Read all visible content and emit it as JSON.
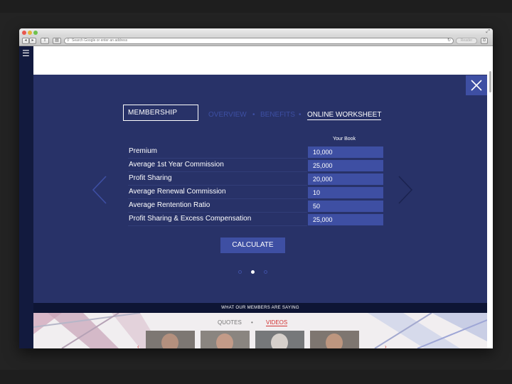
{
  "browser": {
    "address_placeholder": "Search Google or enter an address",
    "reader_label": "Reader"
  },
  "icons": {
    "menu": "hamburger-icon",
    "close": "close-icon",
    "prev": "chevron-left-icon",
    "next": "chevron-right-icon"
  },
  "colors": {
    "page_dark": "#283268",
    "accent_blue": "#3e4fa3",
    "sidebar": "#121a3e",
    "highlight_red": "#d23030"
  },
  "tabs": {
    "membership": "MEMBERSHIP",
    "overview": "OVERVIEW",
    "separator": "•",
    "benefits": "BENEFITS",
    "online_worksheet": "ONLINE WORKSHEET"
  },
  "worksheet": {
    "column_header": "Your Book",
    "rows": [
      {
        "label": "Premium",
        "value": "10,000"
      },
      {
        "label": "Average 1st Year Commission",
        "value": "25,000"
      },
      {
        "label": "Profit Sharing",
        "value": "20,000"
      },
      {
        "label": "Average Renewal Commission",
        "value": "10"
      },
      {
        "label": "Average Rentention Ratio",
        "value": "50"
      },
      {
        "label": "Profit Sharing & Excess Compensation",
        "value": "25,000"
      }
    ],
    "calculate_label": "CALCULATE"
  },
  "pagination": {
    "active_index": 2,
    "total": 3
  },
  "members": {
    "heading": "WHAT OUR MEMBERS ARE SAYING",
    "quotes_label": "QUOTES",
    "separator": "•",
    "videos_label": "VIDEOS"
  }
}
